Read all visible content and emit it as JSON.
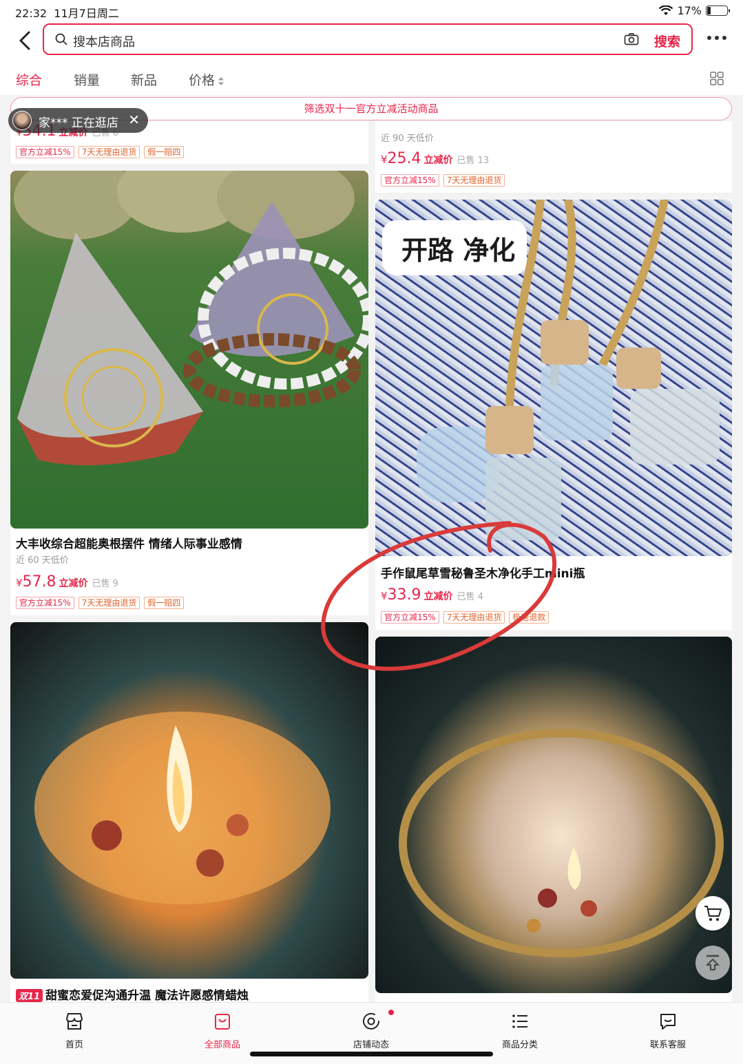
{
  "status": {
    "time": "22:32",
    "date": "11月7日周二",
    "battery": "17%"
  },
  "search": {
    "placeholder": "搜本店商品",
    "button": "搜索"
  },
  "tabs": [
    {
      "label": "综合",
      "active": true
    },
    {
      "label": "销量"
    },
    {
      "label": "新品"
    },
    {
      "label": "价格"
    }
  ],
  "activity_banner": "筛选双十一官方立减活动商品",
  "visitor": {
    "name": "家***",
    "status": "正在逛店"
  },
  "top_partial": {
    "left": {
      "price": "54.1",
      "tag": "立减价",
      "sold": "已售 6"
    },
    "right": {
      "low": "近 90 天低价"
    }
  },
  "products": [
    {
      "title": "",
      "low": "近 90 天低价",
      "currency": "¥",
      "price": "25.4",
      "tag": "立减价",
      "sold": "已售 13",
      "badges": [
        "官方立减15%",
        "7天无理由退货"
      ]
    },
    {
      "title": "大丰收综合超能奥根摆件 情绪人际事业感情",
      "low": "近 60 天低价",
      "currency": "¥",
      "price": "57.8",
      "tag": "立减价",
      "sold": "已售 9",
      "badges": [
        "官方立减15%",
        "7天无理由退货",
        "假一赔四"
      ]
    },
    {
      "title": "手作鼠尾草雪秘鲁圣木净化手工mini瓶",
      "image_text": "开路 净化",
      "currency": "¥",
      "price": "33.9",
      "tag": "立减价",
      "sold": "已售 4",
      "badges": [
        "官方立减15%",
        "7天无理由退货",
        "极速退款"
      ]
    },
    {
      "title": "甜蜜恋爱促沟通升温 魔法许愿感情蜡烛",
      "promo": "双11"
    }
  ],
  "first_row_badges": [
    "官方立减15%",
    "7天无理由退货",
    "假一赔四"
  ],
  "bottom_nav": [
    {
      "label": "首页",
      "icon": "store-icon"
    },
    {
      "label": "全部商品",
      "icon": "bag-icon",
      "active": true
    },
    {
      "label": "店铺动态",
      "icon": "camera-icon"
    },
    {
      "label": "商品分类",
      "icon": "list-icon"
    },
    {
      "label": "联系客服",
      "icon": "chat-icon"
    }
  ],
  "colors": {
    "accent": "#e8254a",
    "badge_orange": "#e0632a"
  }
}
